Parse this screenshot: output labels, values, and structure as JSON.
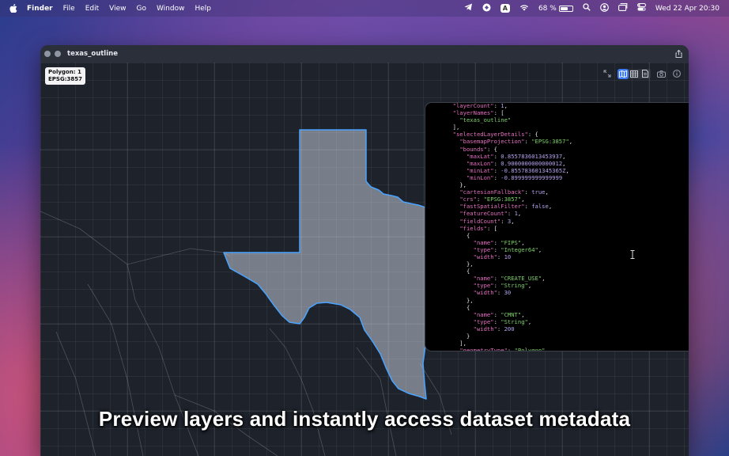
{
  "menubar": {
    "app_name": "Finder",
    "menus": [
      "File",
      "Edit",
      "View",
      "Go",
      "Window",
      "Help"
    ],
    "input_badge": "A",
    "battery_percent": "68 %",
    "battery_level": 0.68,
    "datetime": "Wed 22 Apr  20:30"
  },
  "window": {
    "title": "texas_outline",
    "badge_line1": "Polygon: 1",
    "badge_line2": "EPSG:3857"
  },
  "json_panel": {
    "lines": [
      [
        [
          "p",
          "  "
        ],
        [
          "k",
          "\"layerCount\""
        ],
        [
          "p",
          ": "
        ],
        [
          "n",
          "1"
        ],
        [
          "p",
          ","
        ]
      ],
      [
        [
          "p",
          "  "
        ],
        [
          "k",
          "\"layerNames\""
        ],
        [
          "p",
          ": ["
        ]
      ],
      [
        [
          "p",
          "    "
        ],
        [
          "s",
          "\"texas_outline\""
        ]
      ],
      [
        [
          "p",
          "  ],"
        ]
      ],
      [
        [
          "p",
          "  "
        ],
        [
          "k",
          "\"selectedLayerDetails\""
        ],
        [
          "p",
          ": {"
        ]
      ],
      [
        [
          "p",
          "    "
        ],
        [
          "k",
          "\"basemapProjection\""
        ],
        [
          "p",
          ": "
        ],
        [
          "s",
          "\"EPSG:3857\""
        ],
        [
          "p",
          ","
        ]
      ],
      [
        [
          "p",
          "    "
        ],
        [
          "k",
          "\"bounds\""
        ],
        [
          "p",
          ": {"
        ]
      ],
      [
        [
          "p",
          "      "
        ],
        [
          "k",
          "\"maxLat\""
        ],
        [
          "p",
          ": "
        ],
        [
          "n",
          "0.8557836013453937"
        ],
        [
          "p",
          ","
        ]
      ],
      [
        [
          "p",
          "      "
        ],
        [
          "k",
          "\"maxLon\""
        ],
        [
          "p",
          ": "
        ],
        [
          "n",
          "0.9000000000000012"
        ],
        [
          "p",
          ","
        ]
      ],
      [
        [
          "p",
          "      "
        ],
        [
          "k",
          "\"minLat\""
        ],
        [
          "p",
          ": "
        ],
        [
          "n",
          "-0.855783601345365Z"
        ],
        [
          "p",
          ","
        ]
      ],
      [
        [
          "p",
          "      "
        ],
        [
          "k",
          "\"minLon\""
        ],
        [
          "p",
          ": "
        ],
        [
          "n",
          "-0.899999999999999"
        ]
      ],
      [
        [
          "p",
          "    },"
        ]
      ],
      [
        [
          "p",
          "    "
        ],
        [
          "k",
          "\"cartesianFallback\""
        ],
        [
          "p",
          ": "
        ],
        [
          "b",
          "true"
        ],
        [
          "p",
          ","
        ]
      ],
      [
        [
          "p",
          "    "
        ],
        [
          "k",
          "\"crs\""
        ],
        [
          "p",
          ": "
        ],
        [
          "s",
          "\"EPSG:3857\""
        ],
        [
          "p",
          ","
        ]
      ],
      [
        [
          "p",
          "    "
        ],
        [
          "k",
          "\"fastSpatialFilter\""
        ],
        [
          "p",
          ": "
        ],
        [
          "b",
          "false"
        ],
        [
          "p",
          ","
        ]
      ],
      [
        [
          "p",
          "    "
        ],
        [
          "k",
          "\"featureCount\""
        ],
        [
          "p",
          ": "
        ],
        [
          "n",
          "1"
        ],
        [
          "p",
          ","
        ]
      ],
      [
        [
          "p",
          "    "
        ],
        [
          "k",
          "\"fieldCount\""
        ],
        [
          "p",
          ": "
        ],
        [
          "n",
          "3"
        ],
        [
          "p",
          ","
        ]
      ],
      [
        [
          "p",
          "    "
        ],
        [
          "k",
          "\"fields\""
        ],
        [
          "p",
          ": ["
        ]
      ],
      [
        [
          "p",
          "      {"
        ]
      ],
      [
        [
          "p",
          "        "
        ],
        [
          "k",
          "\"name\""
        ],
        [
          "p",
          ": "
        ],
        [
          "s",
          "\"FIPS\""
        ],
        [
          "p",
          ","
        ]
      ],
      [
        [
          "p",
          "        "
        ],
        [
          "k",
          "\"type\""
        ],
        [
          "p",
          ": "
        ],
        [
          "s",
          "\"Integer64\""
        ],
        [
          "p",
          ","
        ]
      ],
      [
        [
          "p",
          "        "
        ],
        [
          "k",
          "\"width\""
        ],
        [
          "p",
          ": "
        ],
        [
          "n",
          "10"
        ]
      ],
      [
        [
          "p",
          "      },"
        ]
      ],
      [
        [
          "p",
          "      {"
        ]
      ],
      [
        [
          "p",
          "        "
        ],
        [
          "k",
          "\"name\""
        ],
        [
          "p",
          ": "
        ],
        [
          "s",
          "\"CREATE_USE\""
        ],
        [
          "p",
          ","
        ]
      ],
      [
        [
          "p",
          "        "
        ],
        [
          "k",
          "\"type\""
        ],
        [
          "p",
          ": "
        ],
        [
          "s",
          "\"String\""
        ],
        [
          "p",
          ","
        ]
      ],
      [
        [
          "p",
          "        "
        ],
        [
          "k",
          "\"width\""
        ],
        [
          "p",
          ": "
        ],
        [
          "n",
          "30"
        ]
      ],
      [
        [
          "p",
          "      },"
        ]
      ],
      [
        [
          "p",
          "      {"
        ]
      ],
      [
        [
          "p",
          "        "
        ],
        [
          "k",
          "\"name\""
        ],
        [
          "p",
          ": "
        ],
        [
          "s",
          "\"CMNT\""
        ],
        [
          "p",
          ","
        ]
      ],
      [
        [
          "p",
          "        "
        ],
        [
          "k",
          "\"type\""
        ],
        [
          "p",
          ": "
        ],
        [
          "s",
          "\"String\""
        ],
        [
          "p",
          ","
        ]
      ],
      [
        [
          "p",
          "        "
        ],
        [
          "k",
          "\"width\""
        ],
        [
          "p",
          ": "
        ],
        [
          "n",
          "200"
        ]
      ],
      [
        [
          "p",
          "      }"
        ]
      ],
      [
        [
          "p",
          "    ],"
        ]
      ],
      [
        [
          "p",
          "    "
        ],
        [
          "k",
          "\"geometryType\""
        ],
        [
          "p",
          ": "
        ],
        [
          "s",
          "\"Polygon\""
        ],
        [
          "p",
          ","
        ]
      ]
    ]
  },
  "caption": "Preview layers and instantly access dataset metadata",
  "colors": {
    "accent": "#3c7bf5",
    "polygon_stroke": "#4aa3ff",
    "json_key": "#e46fc1",
    "json_string": "#7fd36a",
    "json_number": "#b7a4f0"
  },
  "icons": [
    "apple-icon",
    "telegram-icon",
    "vpn-icon",
    "wifi-icon",
    "battery-icon",
    "search-icon",
    "user-icon",
    "screen-mirror-icon",
    "control-center-icon",
    "close-icon",
    "minimize-icon",
    "share-icon",
    "expand-icon",
    "map-icon",
    "table-icon",
    "document-icon",
    "camera-icon",
    "info-icon",
    "text-cursor-icon"
  ]
}
